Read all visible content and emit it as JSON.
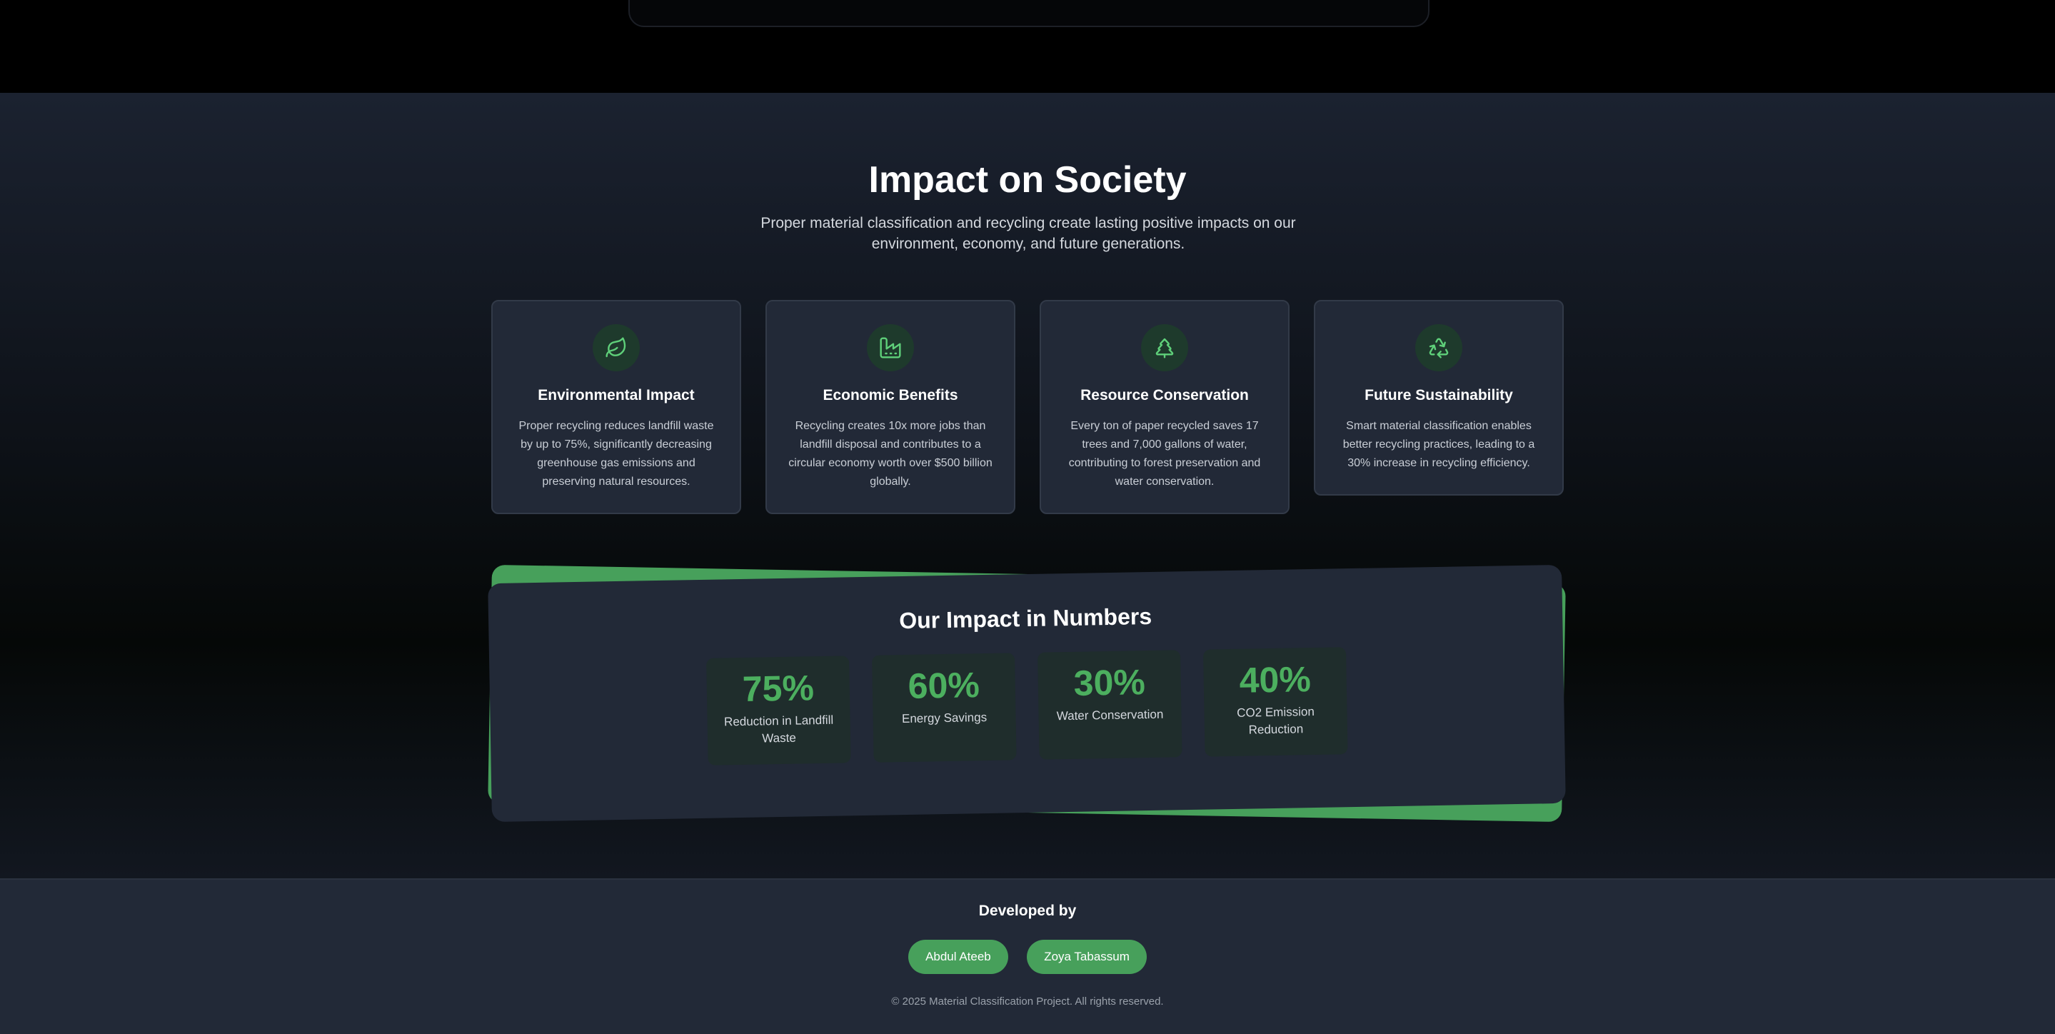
{
  "impact": {
    "title": "Impact on Society",
    "description": "Proper material classification and recycling create lasting positive impacts on our environment, economy, and future generations.",
    "cards": [
      {
        "icon": "leaf-icon",
        "title": "Environmental Impact",
        "text": "Proper recycling reduces landfill waste by up to 75%, significantly decreasing greenhouse gas emissions and preserving natural resources."
      },
      {
        "icon": "factory-icon",
        "title": "Economic Benefits",
        "text": "Recycling creates 10x more jobs than landfill disposal and contributes to a circular economy worth over $500 billion globally."
      },
      {
        "icon": "tree-icon",
        "title": "Resource Conservation",
        "text": "Every ton of paper recycled saves 17 trees and 7,000 gallons of water, contributing to forest preservation and water conservation."
      },
      {
        "icon": "recycle-icon",
        "title": "Future Sustainability",
        "text": "Smart material classification enables better recycling practices, leading to a 30% increase in recycling efficiency."
      }
    ]
  },
  "numbers": {
    "title": "Our Impact in Numbers",
    "stats": [
      {
        "value": "75%",
        "label": "Reduction in Landfill Waste"
      },
      {
        "value": "60%",
        "label": "Energy Savings"
      },
      {
        "value": "30%",
        "label": "Water Conservation"
      },
      {
        "value": "40%",
        "label": "CO2 Emission Reduction"
      }
    ]
  },
  "footer": {
    "developed_by": "Developed by",
    "developers": [
      "Abdul Ateeb",
      "Zoya Tabassum"
    ],
    "copyright": "© 2025 Material Classification Project. All rights reserved."
  },
  "colors": {
    "accent_green": "#47a05b",
    "stat_green": "#4caf5f",
    "card_bg": "#222937",
    "icon_green": "#5fd07a"
  }
}
